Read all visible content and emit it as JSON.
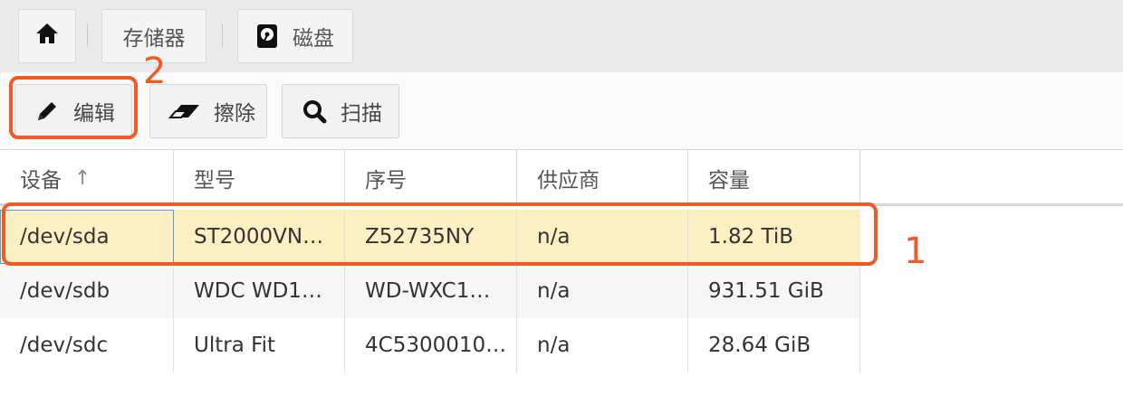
{
  "breadcrumb": {
    "home_icon": "home-icon",
    "items": [
      {
        "label": "存储器"
      },
      {
        "label": "磁盘",
        "icon": "hard-disk-icon"
      }
    ]
  },
  "toolbar": {
    "edit_label": "编辑",
    "edit_icon": "pencil-icon",
    "wipe_label": "擦除",
    "wipe_icon": "eraser-icon",
    "scan_label": "扫描",
    "scan_icon": "search-icon"
  },
  "table": {
    "columns": [
      "设备",
      "型号",
      "序号",
      "供应商",
      "容量"
    ],
    "sort_indicator": "↑",
    "rows": [
      {
        "device": "/dev/sda",
        "model": "ST2000VN…",
        "serial": "Z52735NY",
        "vendor": "n/a",
        "capacity": "1.82 TiB",
        "selected": true
      },
      {
        "device": "/dev/sdb",
        "model": "WDC WD1…",
        "serial": "WD-WXC1…",
        "vendor": "n/a",
        "capacity": "931.51 GiB",
        "selected": false
      },
      {
        "device": "/dev/sdc",
        "model": "Ultra Fit",
        "serial": "4C5300010…",
        "vendor": "n/a",
        "capacity": "28.64 GiB",
        "selected": false
      }
    ]
  },
  "annotations": {
    "row_marker": "1",
    "edit_marker": "2"
  },
  "colors": {
    "annotation": "#f15a24",
    "selected_row": "#fcf0c2"
  }
}
